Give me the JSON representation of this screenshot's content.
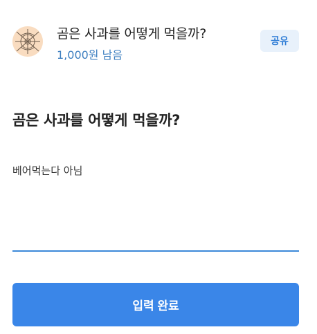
{
  "header": {
    "title": "곰은 사과를 어떻게 먹을까?",
    "remaining": "1,000원 남음",
    "share_label": "공유"
  },
  "question": {
    "text": "곰은 사과를 어떻게 먹을까?"
  },
  "answer": {
    "value": "베어먹는다 아님"
  },
  "submit": {
    "label": "입력 완료"
  },
  "colors": {
    "accent": "#3a86e8",
    "share_bg": "#e8f1fb",
    "remaining_text": "#3d7fc0",
    "avatar_bg": "#f9dcc0"
  },
  "icons": {
    "avatar": "circular-emblem-icon"
  }
}
